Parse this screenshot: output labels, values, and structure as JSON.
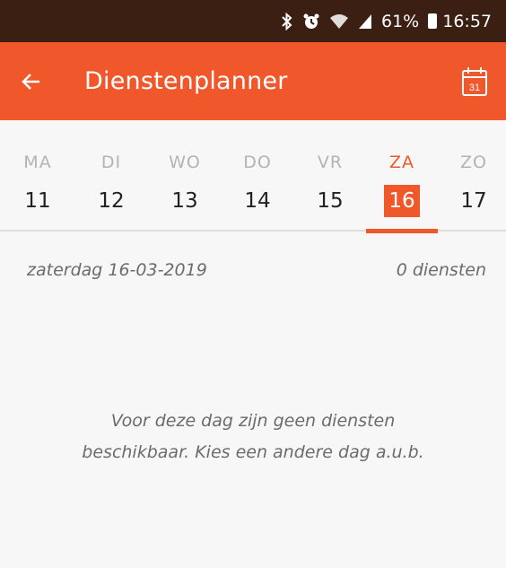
{
  "status_bar": {
    "icons": [
      "bluetooth-icon",
      "alarm-icon",
      "wifi-icon",
      "signal-icon"
    ],
    "battery": "61%",
    "time": "16:57"
  },
  "app_bar": {
    "title": "Dienstenplanner",
    "back_icon": "arrow-left-icon",
    "calendar_icon": "calendar-icon",
    "calendar_number": "31",
    "color": "#f0572a"
  },
  "week": {
    "days": [
      {
        "name": "MA",
        "date": "11"
      },
      {
        "name": "DI",
        "date": "12"
      },
      {
        "name": "WO",
        "date": "13"
      },
      {
        "name": "DO",
        "date": "14"
      },
      {
        "name": "VR",
        "date": "15"
      },
      {
        "name": "ZA",
        "date": "16"
      },
      {
        "name": "ZO",
        "date": "17"
      }
    ],
    "selected_index": 5
  },
  "summary": {
    "date_label": "zaterdag 16-03-2019",
    "count_label": "0 diensten"
  },
  "empty_message": "Voor deze dag zijn geen diensten beschikbaar. Kies een andere dag a.u.b."
}
